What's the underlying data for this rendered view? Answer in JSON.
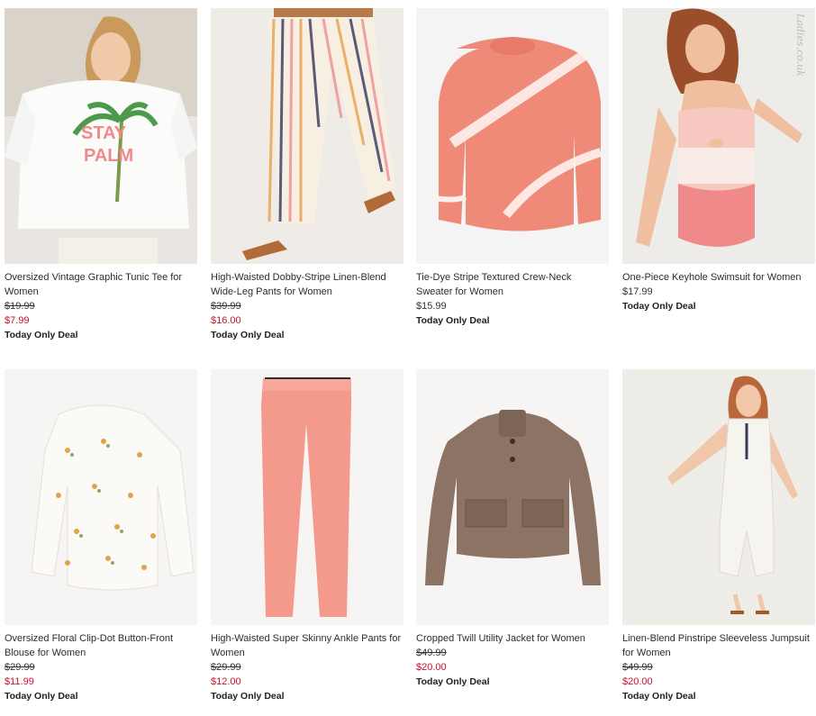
{
  "products": [
    {
      "name": "Oversized Vintage Graphic Tunic Tee for Women",
      "orig_price": "$19.99",
      "sale_price": "$7.99",
      "deal": "Today Only Deal",
      "graphic_text": "STAY\nPALM"
    },
    {
      "name": "High-Waisted Dobby-Stripe Linen-Blend Wide-Leg Pants for Women",
      "orig_price": "$39.99",
      "sale_price": "$16.00",
      "deal": "Today Only Deal"
    },
    {
      "name": "Tie-Dye Stripe Textured Crew-Neck Sweater for Women",
      "price": "$15.99",
      "deal": "Today Only Deal"
    },
    {
      "name": "One-Piece Keyhole Swimsuit for Women",
      "price": "$17.99",
      "deal": "Today Only Deal"
    },
    {
      "name": "Oversized Floral Clip-Dot Button-Front Blouse for Women",
      "orig_price": "$29.99",
      "sale_price": "$11.99",
      "deal": "Today Only Deal"
    },
    {
      "name": "High-Waisted Super Skinny Ankle Pants for Women",
      "orig_price": "$29.99",
      "sale_price": "$12.00",
      "deal": "Today Only Deal"
    },
    {
      "name": "Cropped Twill Utility Jacket for Women",
      "orig_price": "$49.99",
      "sale_price": "$20.00",
      "deal": "Today Only Deal"
    },
    {
      "name": "Linen-Blend Pinstripe Sleeveless Jumpsuit for Women",
      "orig_price": "$49.99",
      "sale_price": "$20.00",
      "deal": "Today Only Deal"
    }
  ],
  "watermark": "Ladies.co.uk",
  "colors": {
    "sale": "#c8102e",
    "text": "#2d2d2d"
  }
}
